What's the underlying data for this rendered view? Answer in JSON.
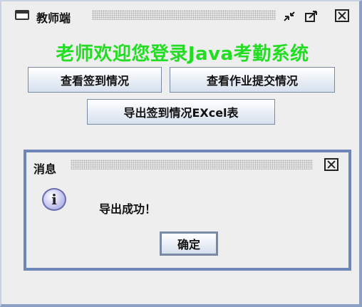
{
  "window": {
    "title": "教师端",
    "controls": [
      "minimize-icon",
      "maximize-icon",
      "close-icon"
    ]
  },
  "main": {
    "welcome_text": "老师欢迎您登录Java考勤系统",
    "welcome_color": "#22dd22",
    "buttons": {
      "view_checkin": "查看签到情况",
      "view_homework": "查看作业提交情况",
      "export_excel": "导出签到情况EXcel表"
    }
  },
  "dialog": {
    "title": "消息",
    "icon": "info-icon",
    "message": "导出成功！",
    "ok_label": "确定"
  }
}
